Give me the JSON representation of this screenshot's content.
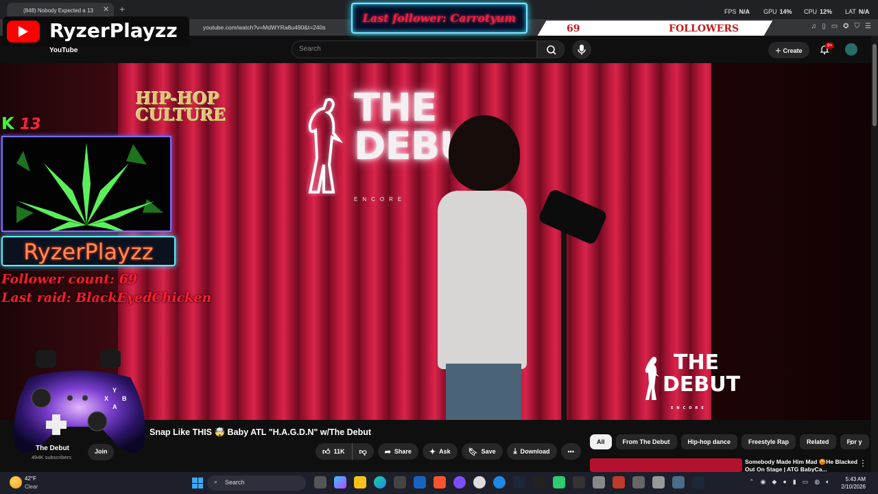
{
  "browser": {
    "tab_title": "(848) Nobody Expected a 13",
    "tab_close": "✕",
    "new_tab": "+",
    "url": "youtube.com/watch?v=MdWYRa8u490&t=240s"
  },
  "overlay_stats": {
    "fps_label": "FPS",
    "fps_value": "N/A",
    "gpu_label": "GPU",
    "gpu_value": "14%",
    "cpu_label": "CPU",
    "cpu_value": "12%",
    "lat_label": "LAT",
    "lat_value": "N/A"
  },
  "stream_overlay": {
    "streamer_name": "RyzerPlayzz",
    "last_follower": "Last follower: Carrotyum",
    "followers_count": "69",
    "followers_label": "FOLLOWERS",
    "k_prefix": "K",
    "k_number": "13",
    "banner_name": "RyzerPlayzz",
    "follower_count_line": "Follower count: 69",
    "last_raid_line": "Last raid: BlackEyedChicken"
  },
  "youtube": {
    "logo_text": "YouTube",
    "search_placeholder": "Search",
    "create_label": "Create",
    "notif_badge": "9+"
  },
  "video": {
    "stage_sign": "THE DEBUT",
    "stage_sign_sub": "ENCORE",
    "watermark_line1": "THE",
    "watermark_line2": "DEBUT",
    "watermark_sub": "ENCORE",
    "hiphop_line1": "HIP-HOP",
    "hiphop_line2": "CULTURE"
  },
  "below_video": {
    "title": "Snap Like THIS 🤯 Baby ATL \"H.A.G.D.N\" w/The Debut",
    "channel_name": "The Debut",
    "subscribers": "494K subscribers",
    "join_label": "Join",
    "like_count": "11K",
    "share_label": "Share",
    "ask_label": "Ask",
    "save_label": "Save",
    "download_label": "Download",
    "more_label": "•••"
  },
  "chips": [
    "All",
    "From The Debut",
    "Hip-hop dance",
    "Freestyle Rap",
    "Related",
    "For y"
  ],
  "recommendation": {
    "title": "Somebody Made Him Mad 😡He Blacked Out On Stage | ATG BabyCa..."
  },
  "taskbar": {
    "temp": "42°F",
    "condition": "Clear",
    "search_label": "Search",
    "time": "5:43 AM",
    "date": "2/10/2026"
  }
}
